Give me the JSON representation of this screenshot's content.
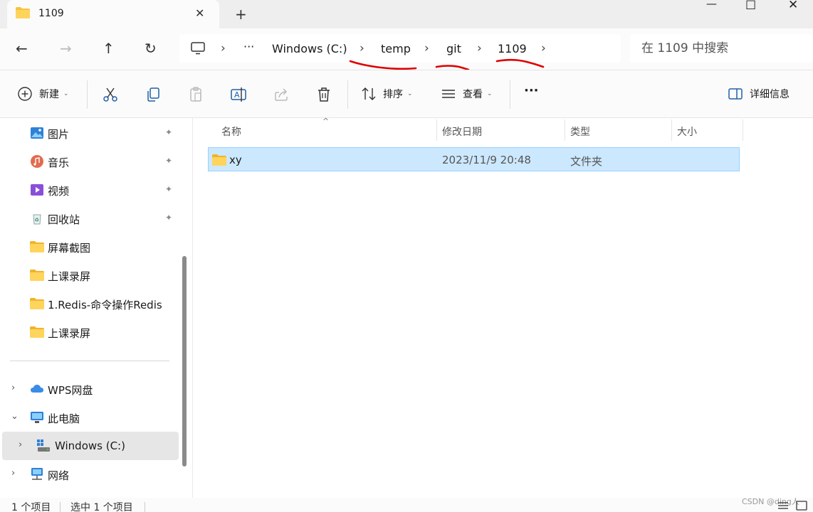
{
  "tab": {
    "title": "1109",
    "close_glyph": "✕",
    "new_glyph": "+"
  },
  "window": {
    "minimize": "—",
    "maximize": "☐",
    "close": "✕"
  },
  "nav": {
    "back": "←",
    "forward": "→",
    "up": "↑",
    "refresh": "↻",
    "breadcrumb_more": "···",
    "breadcrumb": [
      "Windows (C:)",
      "temp",
      "git",
      "1109"
    ],
    "chevron": "›",
    "search_placeholder": "在 1109 中搜索"
  },
  "toolbar": {
    "new_label": "新建",
    "sort_label": "排序",
    "view_label": "查看",
    "more_label": "···",
    "details_label": "详细信息",
    "caret": "⌄"
  },
  "sidebar": {
    "quick": [
      {
        "label": "图片",
        "icon": "pictures-icon",
        "pinned": true
      },
      {
        "label": "音乐",
        "icon": "music-icon",
        "pinned": true
      },
      {
        "label": "视频",
        "icon": "video-icon",
        "pinned": true
      },
      {
        "label": "回收站",
        "icon": "recycle-bin-icon",
        "pinned": true
      },
      {
        "label": "屏幕截图",
        "icon": "folder-icon",
        "pinned": false
      },
      {
        "label": "上课录屏",
        "icon": "folder-icon",
        "pinned": false
      },
      {
        "label": "1.Redis-命令操作Redis",
        "icon": "folder-icon",
        "pinned": false
      },
      {
        "label": "上课录屏",
        "icon": "folder-icon",
        "pinned": false
      }
    ],
    "tree": [
      {
        "label": "WPS网盘",
        "icon": "cloud-icon",
        "expander": "›"
      },
      {
        "label": "此电脑",
        "icon": "this-pc-icon",
        "expander": "⌄"
      },
      {
        "label": "Windows (C:)",
        "icon": "drive-icon",
        "expander": "›"
      },
      {
        "label": "网络",
        "icon": "network-icon",
        "expander": "›"
      }
    ],
    "pin_glyph": "📌"
  },
  "filelist": {
    "columns": [
      "名称",
      "修改日期",
      "类型",
      "大小"
    ],
    "sort_glyph": "^",
    "rows": [
      {
        "name": "xy",
        "modified": "2023/11/9 20:48",
        "type": "文件夹",
        "size": ""
      }
    ]
  },
  "status": {
    "item_count": "1 个项目",
    "selected": "选中 1 个项目",
    "watermark": "CSDN @ding人"
  },
  "colors": {
    "accent": "#0067c0",
    "selection": "#cce8ff",
    "annotation": "#e00000",
    "folder": "#f8c33c"
  }
}
